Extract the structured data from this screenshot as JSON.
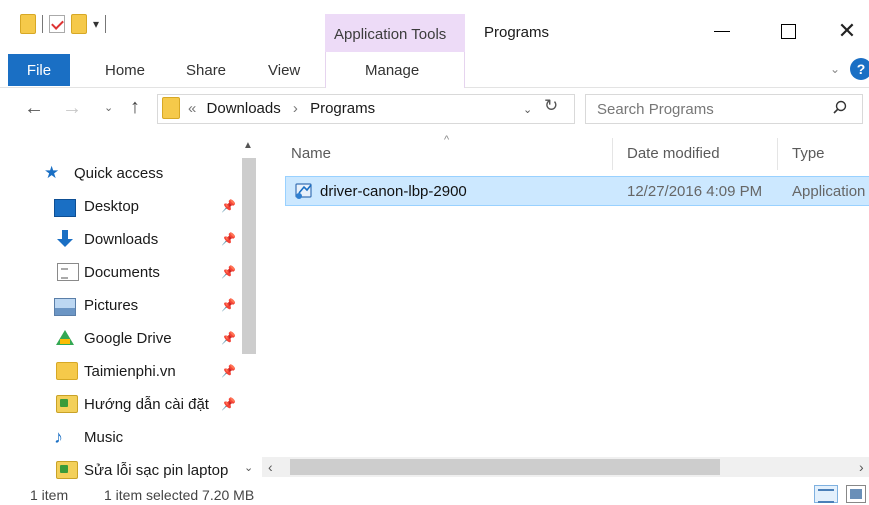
{
  "window": {
    "title": "Programs",
    "context_tab_group": "Application Tools",
    "minimize_glyph": "",
    "maximize_glyph": "",
    "close_glyph": "✕"
  },
  "quick_access_toolbar": {
    "dropdown_glyph": "▾"
  },
  "ribbon": {
    "tabs": {
      "file": "File",
      "home": "Home",
      "share": "Share",
      "view": "View",
      "manage": "Manage"
    },
    "expand_glyph": "⌄",
    "help_glyph": "?"
  },
  "navigation": {
    "back_glyph": "←",
    "forward_glyph": "→",
    "recent_glyph": "⌄",
    "up_glyph": "↑",
    "overflow_glyph": "«",
    "breadcrumb": [
      "Downloads",
      "Programs"
    ],
    "breadcrumb_sep": "›",
    "address_dropdown_glyph": "⌄",
    "refresh_glyph": "↻"
  },
  "search": {
    "placeholder": "Search Programs"
  },
  "nav_pane": {
    "quick_access": "Quick access",
    "items": [
      {
        "label": "Desktop",
        "icon": "desktop-icon",
        "pinned": true
      },
      {
        "label": "Downloads",
        "icon": "downloads-icon",
        "pinned": true
      },
      {
        "label": "Documents",
        "icon": "documents-icon",
        "pinned": true
      },
      {
        "label": "Pictures",
        "icon": "pictures-icon",
        "pinned": true
      },
      {
        "label": "Google Drive",
        "icon": "google-drive-icon",
        "pinned": true
      },
      {
        "label": "Taimienphi.vn",
        "icon": "folder-icon",
        "pinned": true
      },
      {
        "label": "Hướng dẫn cài đặt",
        "icon": "setup-folder-icon",
        "pinned": true
      },
      {
        "label": "Music",
        "icon": "music-icon",
        "pinned": false
      },
      {
        "label": "Sửa lỗi sạc pin laptop",
        "icon": "setup-folder-icon",
        "pinned": false
      }
    ],
    "pin_glyph": "📌",
    "scroll_up_glyph": "▲",
    "scroll_down_glyph": "⌄"
  },
  "file_list": {
    "columns": {
      "name": "Name",
      "date_modified": "Date modified",
      "type": "Type"
    },
    "sort_glyph": "^",
    "rows": [
      {
        "name": "driver-canon-lbp-2900",
        "date_modified": "12/27/2016 4:09 PM",
        "type": "Application",
        "selected": true
      }
    ],
    "h_scroll_left_glyph": "‹",
    "h_scroll_right_glyph": "›"
  },
  "status_bar": {
    "item_count": "1 item",
    "selection": "1 item selected 7.20 MB"
  },
  "colors": {
    "accent": "#1a6fc4",
    "context_tab": "#eddbf7",
    "selection_bg": "#cce8ff",
    "selection_border": "#99d1ff"
  }
}
